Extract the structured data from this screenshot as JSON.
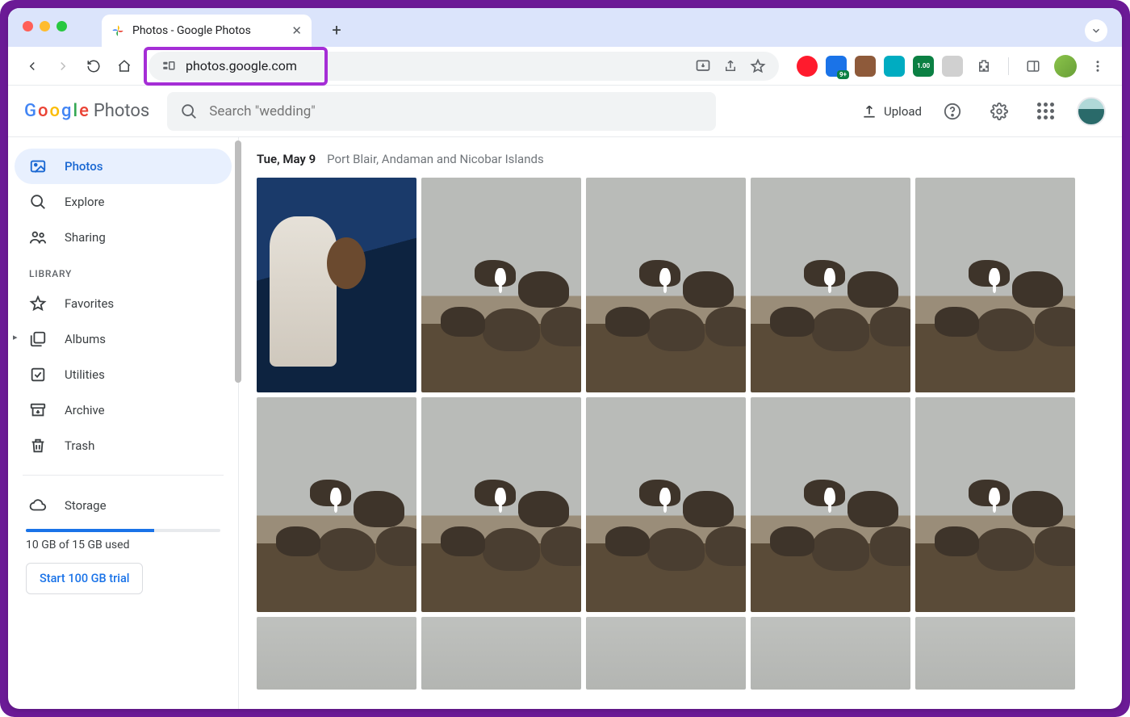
{
  "browser": {
    "tab_title": "Photos - Google Photos",
    "url": "photos.google.com",
    "ext_badge_blue": "9+",
    "ext_badge_green": "1.00"
  },
  "app": {
    "brand_suffix": "Photos",
    "search_placeholder": "Search \"wedding\"",
    "upload_label": "Upload"
  },
  "sidebar": {
    "items": {
      "photos": "Photos",
      "explore": "Explore",
      "sharing": "Sharing"
    },
    "library_label": "LIBRARY",
    "library": {
      "favorites": "Favorites",
      "albums": "Albums",
      "utilities": "Utilities",
      "archive": "Archive",
      "trash": "Trash"
    },
    "storage": {
      "label": "Storage",
      "used_text": "10 GB of 15 GB used",
      "used_pct": 66,
      "trial_button": "Start 100 GB trial"
    }
  },
  "main": {
    "date": "Tue, May 9",
    "location": "Port Blair, Andaman and Nicobar Islands"
  }
}
